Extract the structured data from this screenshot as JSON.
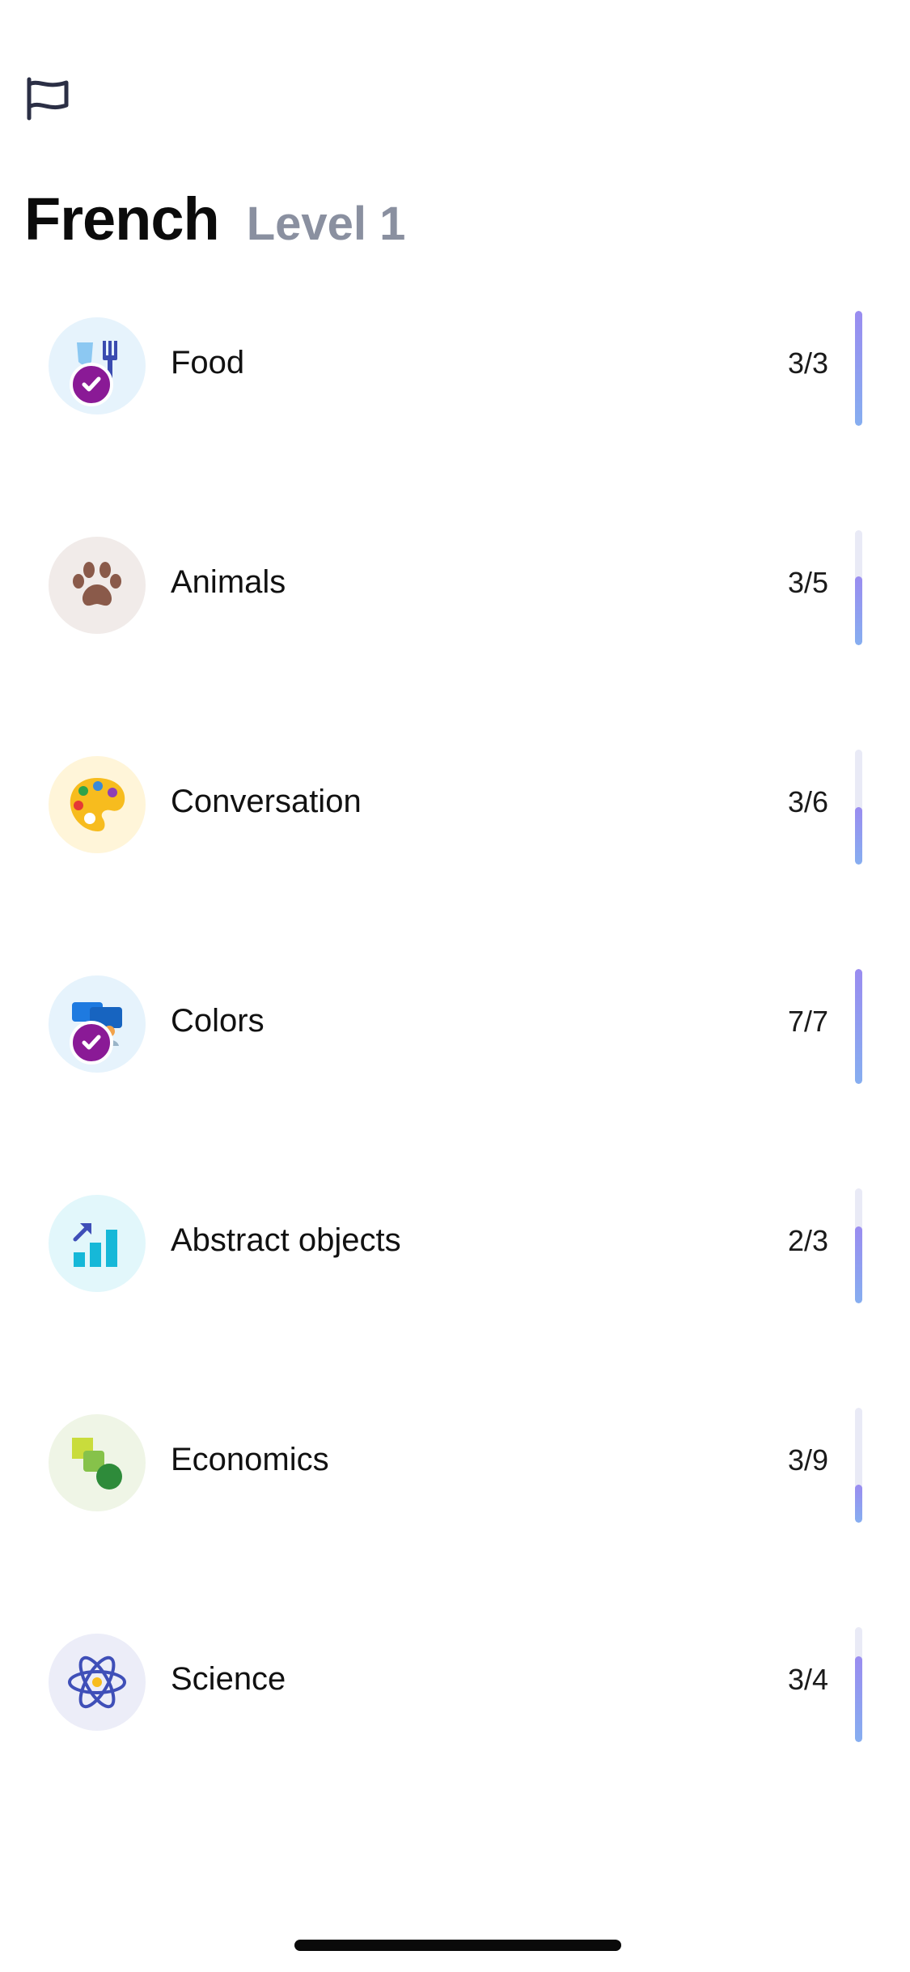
{
  "header": {
    "title": "French",
    "level": "Level 1",
    "flag_icon": "flag-icon"
  },
  "colors": {
    "completed_badge": "#8a1a96",
    "progress_fill": "#9a8cf0",
    "progress_track": "#e9eaf6",
    "level_text": "#8a90a0"
  },
  "topics": [
    {
      "label": "Food",
      "count": "3/3",
      "completed": 3,
      "total": 3,
      "icon": "food-icon",
      "done": true,
      "bg": "#e6f3fc"
    },
    {
      "label": "Animals",
      "count": "3/5",
      "completed": 3,
      "total": 5,
      "icon": "paw-icon",
      "done": false,
      "bg": "#f1ebe9"
    },
    {
      "label": "Conversation",
      "count": "3/6",
      "completed": 3,
      "total": 6,
      "icon": "palette-icon",
      "done": false,
      "bg": "#fff5d9"
    },
    {
      "label": "Colors",
      "count": "7/7",
      "completed": 7,
      "total": 7,
      "icon": "people-chat-icon",
      "done": true,
      "bg": "#e6f3fc"
    },
    {
      "label": "Abstract objects",
      "count": "2/3",
      "completed": 2,
      "total": 3,
      "icon": "bar-chart-icon",
      "done": false,
      "bg": "#e2f7fb"
    },
    {
      "label": "Economics",
      "count": "3/9",
      "completed": 3,
      "total": 9,
      "icon": "shapes-icon",
      "done": false,
      "bg": "#eff5e6"
    },
    {
      "label": "Science",
      "count": "3/4",
      "completed": 3,
      "total": 4,
      "icon": "atom-icon",
      "done": false,
      "bg": "#ecedf8"
    }
  ]
}
